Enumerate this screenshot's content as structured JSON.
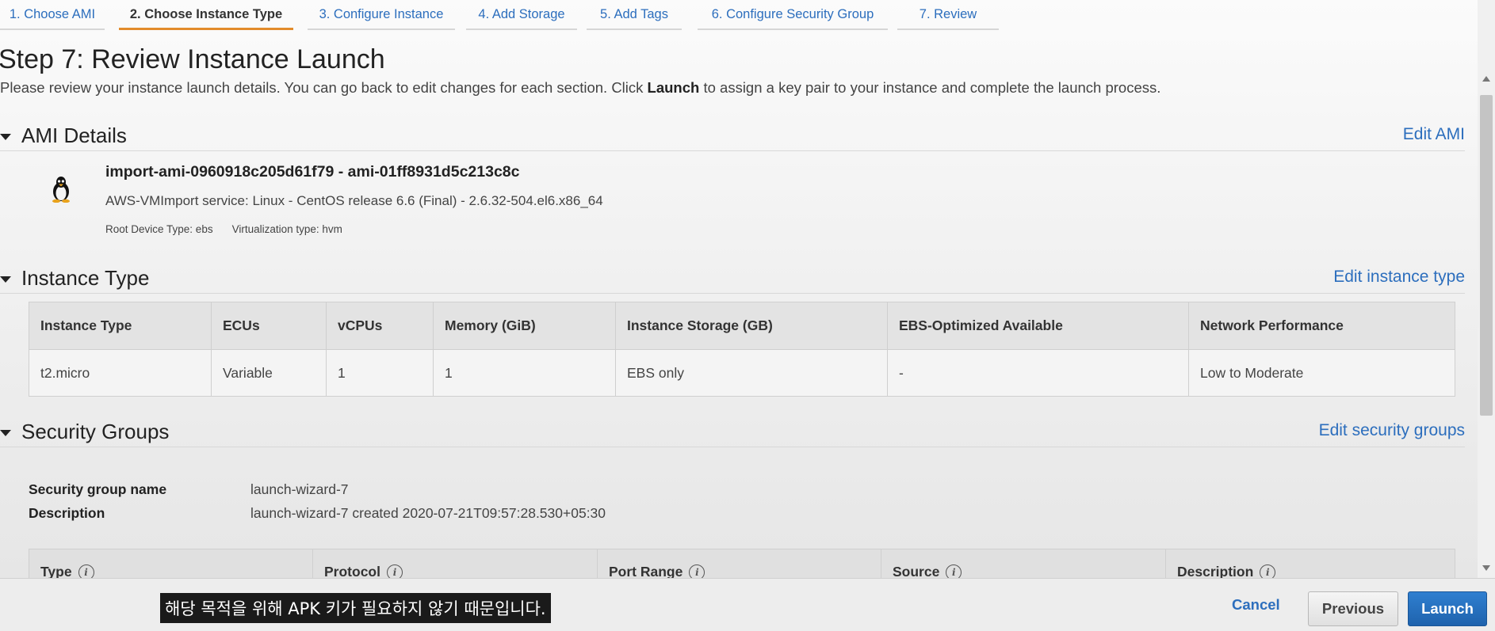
{
  "wizard_tabs": [
    {
      "label": "1. Choose AMI"
    },
    {
      "label": "2. Choose Instance Type"
    },
    {
      "label": "3. Configure Instance"
    },
    {
      "label": "4. Add Storage"
    },
    {
      "label": "5. Add Tags"
    },
    {
      "label": "6. Configure Security Group"
    },
    {
      "label": "7. Review"
    }
  ],
  "active_tab": "2. Choose Instance Type",
  "page": {
    "title": "Step 7: Review Instance Launch",
    "description_before": "Please review your instance launch details. You can go back to edit changes for each section. Click ",
    "description_bold": "Launch",
    "description_after": " to assign a key pair to your instance and complete the launch process."
  },
  "ami_section": {
    "title": "AMI Details",
    "edit_link": "Edit AMI",
    "icon": "linux-penguin-icon",
    "name": "import-ami-0960918c205d61f79 - ami-01ff8931d5c213c8c",
    "description": "AWS-VMImport service: Linux - CentOS release 6.6 (Final) - 2.6.32-504.el6.x86_64",
    "root_device": "Root Device Type: ebs",
    "virtualization": "Virtualization type: hvm"
  },
  "instance_section": {
    "title": "Instance Type",
    "edit_link": "Edit instance type",
    "columns": [
      "Instance Type",
      "ECUs",
      "vCPUs",
      "Memory (GiB)",
      "Instance Storage (GB)",
      "EBS-Optimized Available",
      "Network Performance"
    ],
    "row": [
      "t2.micro",
      "Variable",
      "1",
      "1",
      "EBS only",
      "-",
      "Low to Moderate"
    ]
  },
  "security_section": {
    "title": "Security Groups",
    "edit_link": "Edit security groups",
    "name_label": "Security group name",
    "name_value": "launch-wizard-7",
    "desc_label": "Description",
    "desc_value": "launch-wizard-7 created 2020-07-21T09:57:28.530+05:30",
    "rule_columns": [
      "Type",
      "Protocol",
      "Port Range",
      "Source",
      "Description"
    ]
  },
  "footer": {
    "caption": "해당 목적을 위해 APK 키가 필요하지 않기 때문입니다.",
    "cancel": "Cancel",
    "previous": "Previous",
    "launch": "Launch"
  },
  "colors": {
    "link": "#2c6ebd",
    "active_tab_underline": "#e28b2b",
    "launch_button": "#1f63ad"
  }
}
